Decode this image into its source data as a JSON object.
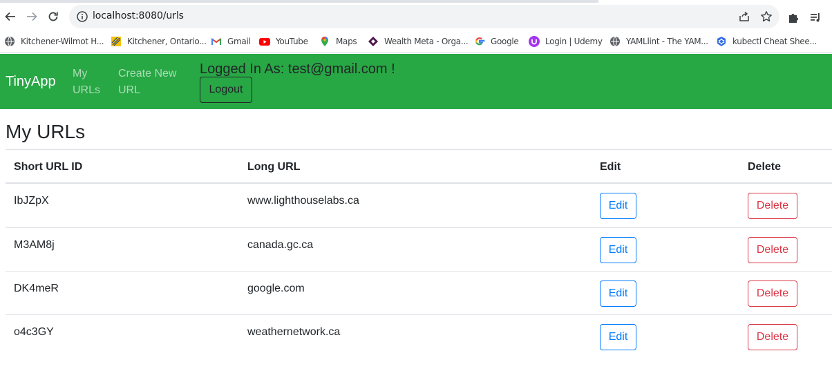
{
  "browser": {
    "url": "localhost:8080/urls",
    "bookmarks": [
      {
        "label": "Kitchener-Wilmot H...",
        "icon": "globe-icon"
      },
      {
        "label": "Kitchener, Ontario...",
        "icon": "kitchener-favicon-icon"
      },
      {
        "label": "Gmail",
        "icon": "gmail-icon"
      },
      {
        "label": "YouTube",
        "icon": "youtube-icon"
      },
      {
        "label": "Maps",
        "icon": "maps-pin-icon"
      },
      {
        "label": "Wealth Meta - Orga...",
        "icon": "wealth-meta-icon"
      },
      {
        "label": "Google",
        "icon": "google-icon"
      },
      {
        "label": "Login | Udemy",
        "icon": "udemy-icon"
      },
      {
        "label": "YAMLlint - The YAM...",
        "icon": "globe-icon"
      },
      {
        "label": "kubectl Cheat Shee...",
        "icon": "kubernetes-icon"
      }
    ]
  },
  "navbar": {
    "brand": "TinyApp",
    "my_urls_line1": "My",
    "my_urls_line2": "URLs",
    "create_line1": "Create New",
    "create_line2": "URL",
    "logged_in": "Logged In As: test@gmail.com !",
    "logout": "Logout"
  },
  "main": {
    "title": "My URLs",
    "columns": [
      "Short URL ID",
      "Long URL",
      "Edit",
      "Delete"
    ],
    "rows": [
      {
        "id": "IbJZpX",
        "long": "www.lighthouselabs.ca"
      },
      {
        "id": "M3AM8j",
        "long": "canada.gc.ca"
      },
      {
        "id": "DK4meR",
        "long": "google.com"
      },
      {
        "id": "o4c3GY",
        "long": "weathernetwork.ca"
      }
    ],
    "edit_label": "Edit",
    "delete_label": "Delete"
  },
  "colors": {
    "navbar": "#28a745",
    "edit": "#007bff",
    "delete": "#dc3545"
  }
}
